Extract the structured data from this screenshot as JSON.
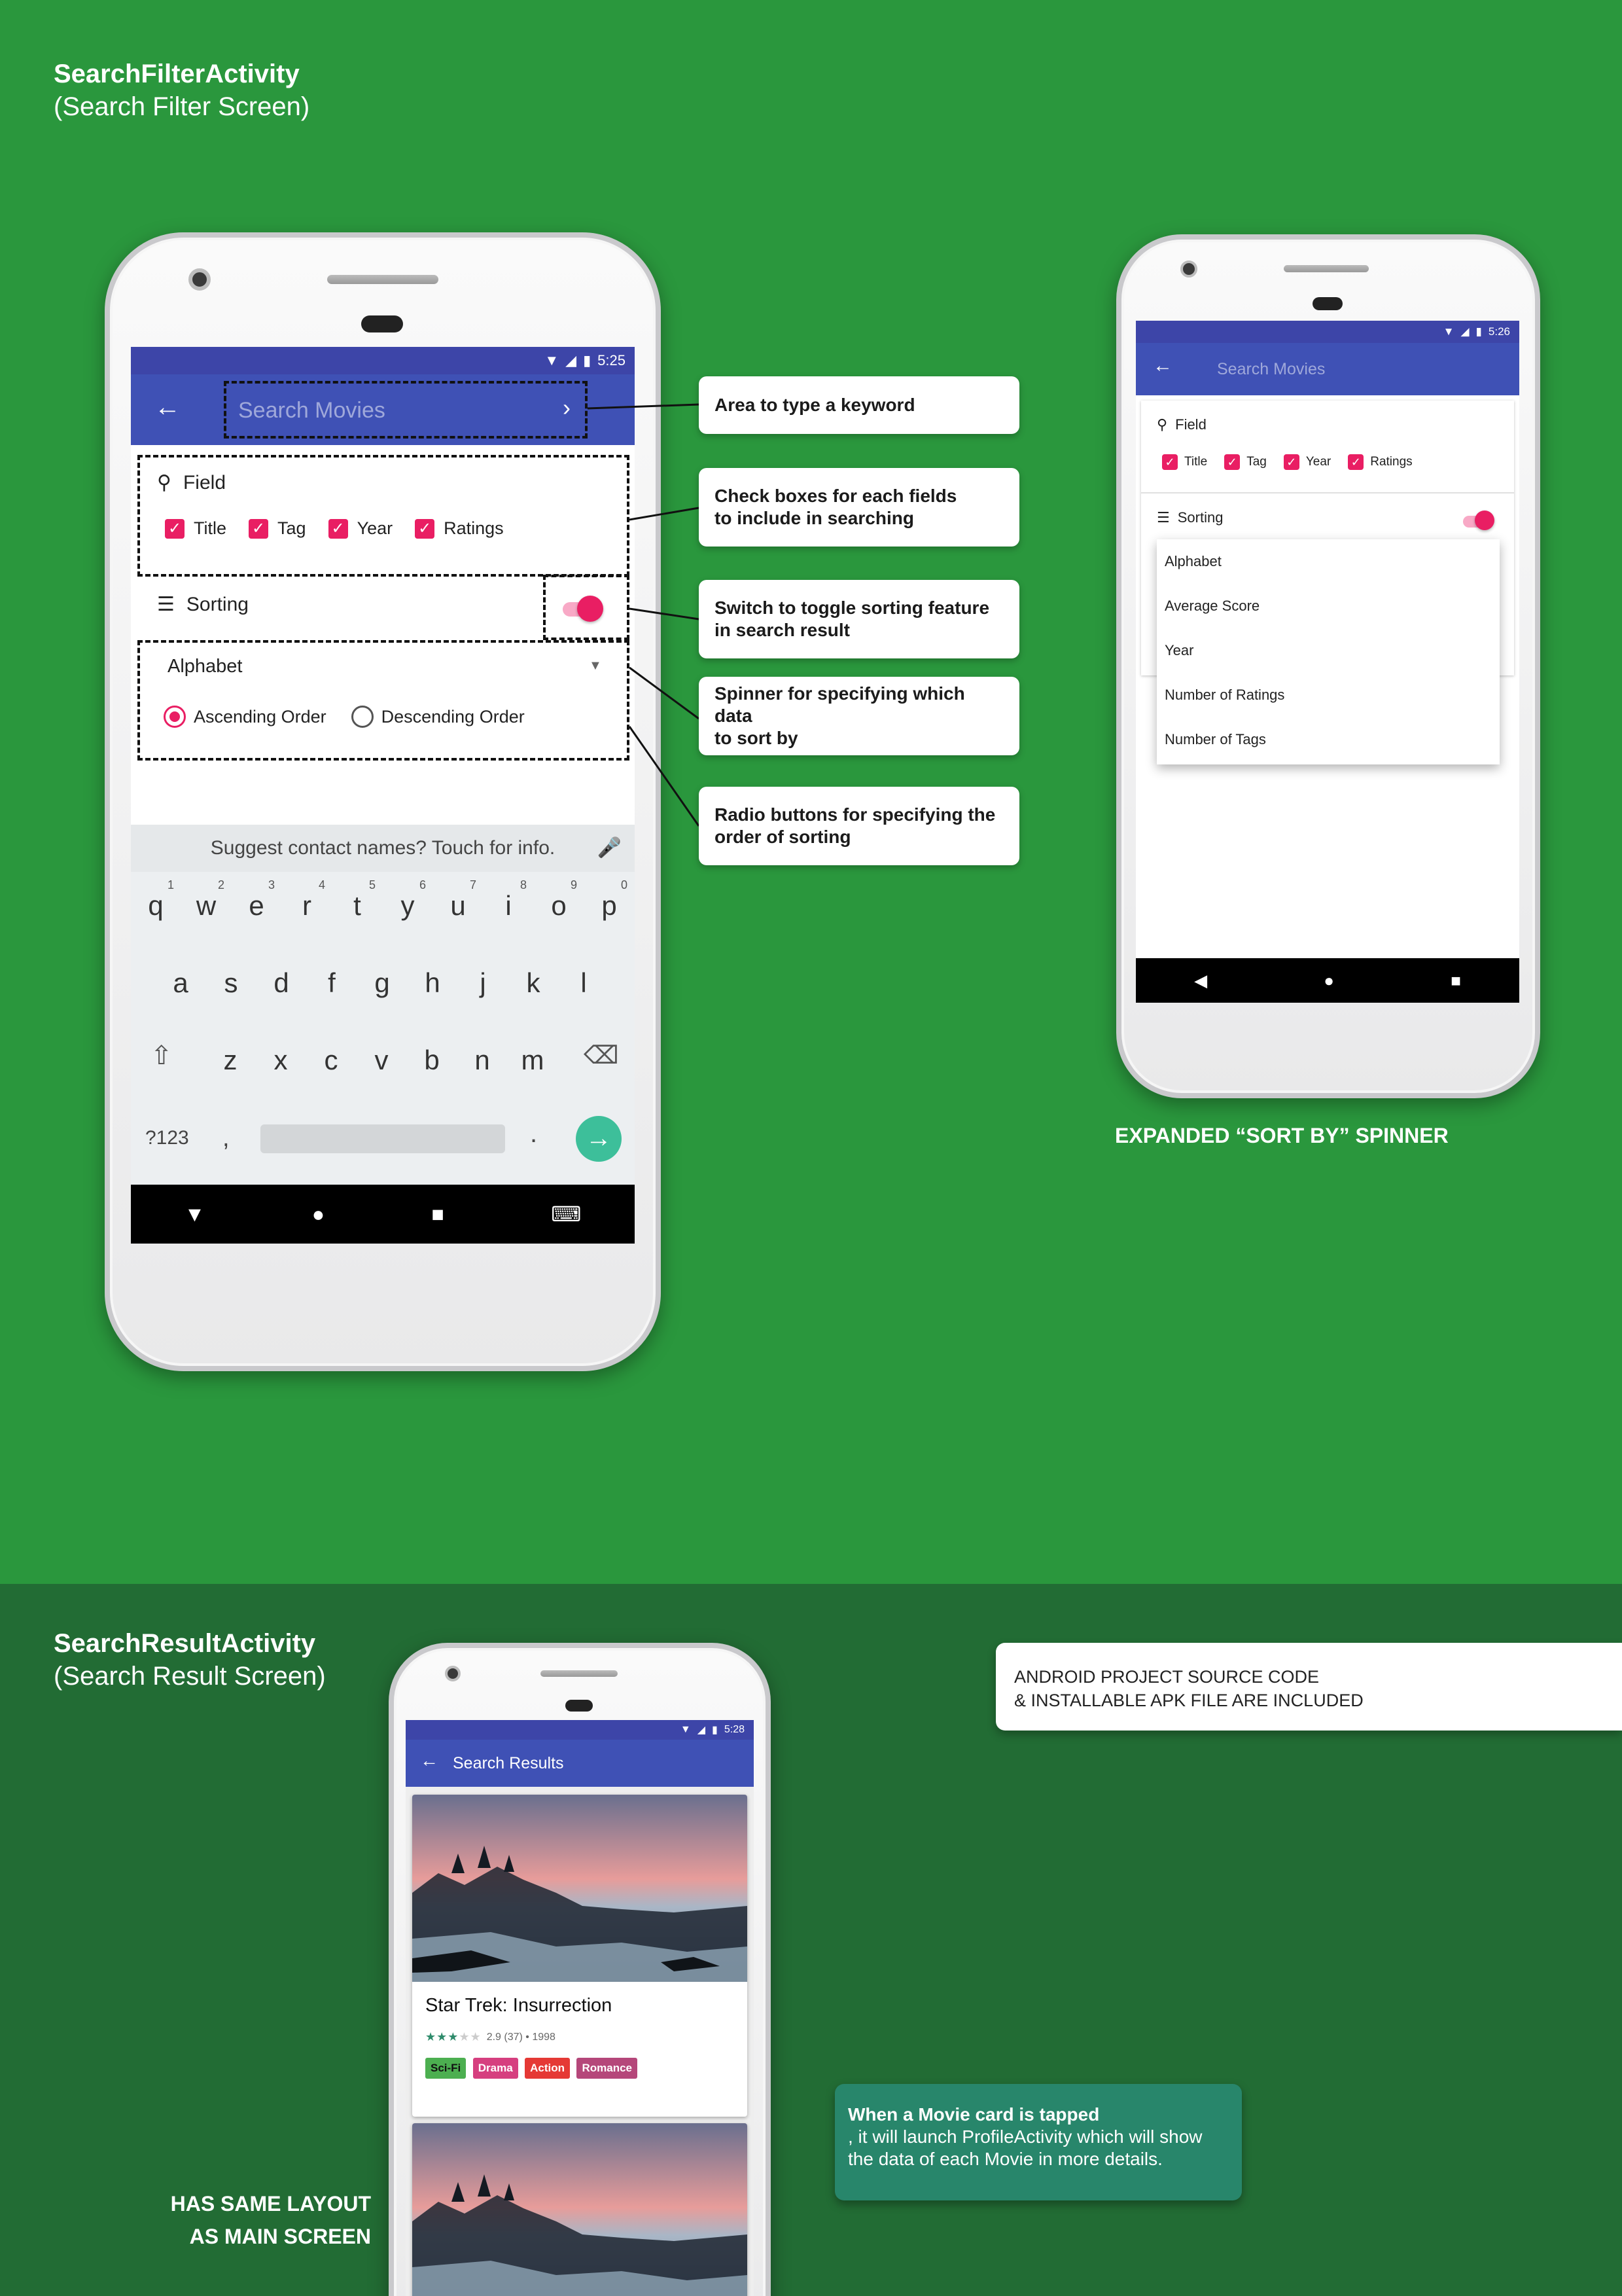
{
  "top_section": {
    "title": "SearchFilterActivity",
    "subtitle": "(Search Filter Screen)"
  },
  "bottom_section": {
    "title": "SearchResultActivity",
    "subtitle": "(Search Result Screen)"
  },
  "colors": {
    "background_top": "#2a973d",
    "background_bottom": "#226c34",
    "appbar": "#3f51b5",
    "accent": "#e91e63"
  },
  "phone1": {
    "status_time": "5:25",
    "search_placeholder": "Search Movies",
    "field_label": "Field",
    "checkboxes": [
      "Title",
      "Tag",
      "Year",
      "Ratings"
    ],
    "sorting_label": "Sorting",
    "spinner_value": "Alphabet",
    "radio_ascending": "Ascending Order",
    "radio_descending": "Descending Order",
    "keyboard_suggestion": "Suggest contact names? Touch for info.",
    "key_numbers": [
      "1",
      "2",
      "3",
      "4",
      "5",
      "6",
      "7",
      "8",
      "9",
      "0"
    ],
    "row1": [
      "q",
      "w",
      "e",
      "r",
      "t",
      "y",
      "u",
      "i",
      "o",
      "p"
    ],
    "row2": [
      "a",
      "s",
      "d",
      "f",
      "g",
      "h",
      "j",
      "k",
      "l"
    ],
    "row3": [
      "z",
      "x",
      "c",
      "v",
      "b",
      "n",
      "m"
    ],
    "symbols_key": "?123",
    "comma_key": ",",
    "period_key": "."
  },
  "phone2": {
    "status_time": "5:26",
    "search_placeholder": "Search Movies",
    "field_label": "Field",
    "checkboxes": [
      "Title",
      "Tag",
      "Year",
      "Ratings"
    ],
    "sorting_label": "Sorting",
    "dropdown_options": [
      "Alphabet",
      "Average Score",
      "Year",
      "Number of Ratings",
      "Number of Tags"
    ],
    "caption": "EXPANDED “SORT BY” SPINNER"
  },
  "phone3": {
    "status_time": "5:28",
    "appbar_title": "Search Results",
    "movie_title": "Star Trek: Insurrection",
    "movie_rating": 2.9,
    "movie_meta": "2.9 (37) • 1998",
    "tags": [
      {
        "label": "Sci-Fi",
        "color": "#4caf50"
      },
      {
        "label": "Drama",
        "color": "#d63f7f"
      },
      {
        "label": "Action",
        "color": "#e53935"
      },
      {
        "label": "Romance",
        "color": "#b5477a"
      }
    ]
  },
  "callouts": {
    "keyword": "Area to type a keyword",
    "checkboxes_line1": "Check boxes for each fields",
    "checkboxes_line2": "to include in searching",
    "switch_line1": "Switch to toggle sorting feature",
    "switch_line2": "in search result",
    "spinner_line1": "Spinner for specifying which data",
    "spinner_line2": "to sort by",
    "radio_line1": "Radio buttons for specifying the",
    "radio_line2": "order of sorting"
  },
  "source_note": {
    "line1": "ANDROID PROJECT SOURCE CODE",
    "line2": "& INSTALLABLE APK FILE ARE INCLUDED"
  },
  "movie_card_note": {
    "title": "When a Movie card is tapped",
    "body": ", it will launch ProfileActivity which will show the data of each Movie in more details."
  },
  "same_layout_caption": {
    "line1": "HAS SAME LAYOUT",
    "line2": "AS MAIN SCREEN"
  }
}
